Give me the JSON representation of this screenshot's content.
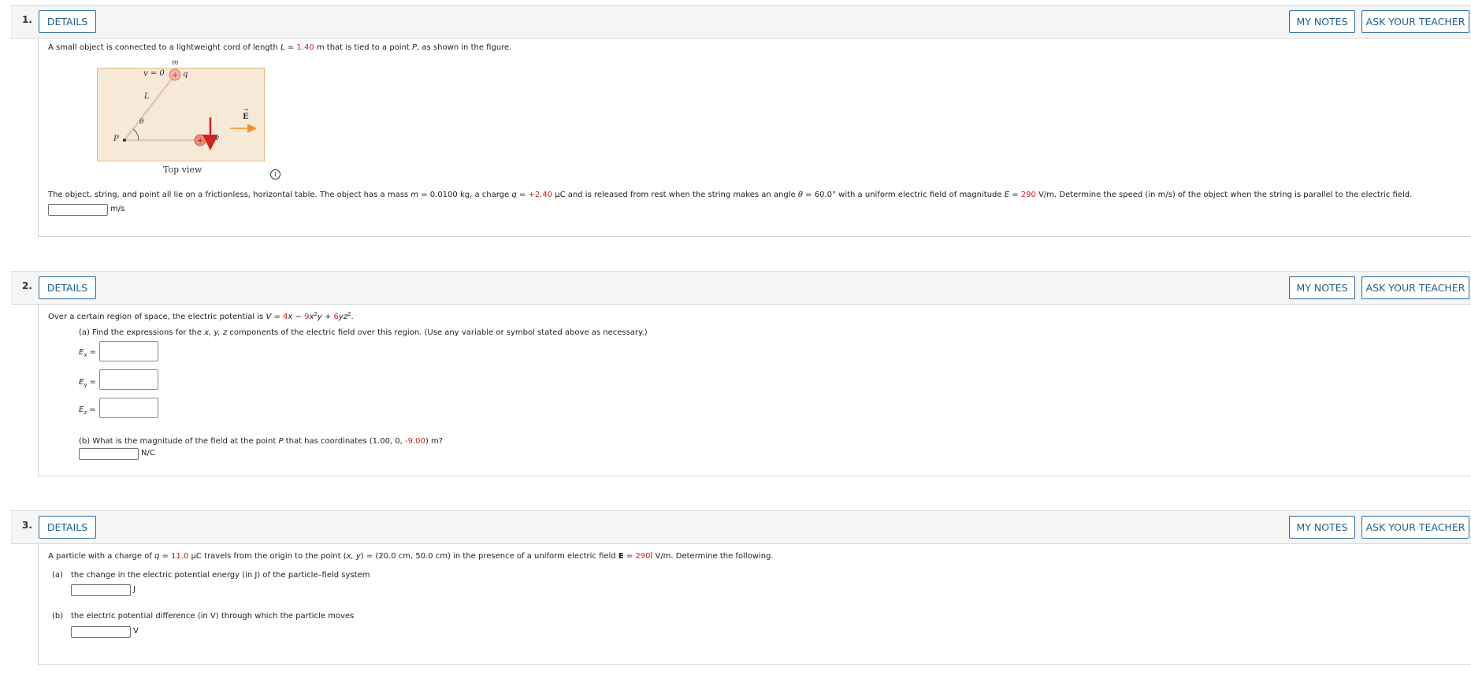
{
  "questions": [
    {
      "number": "1.",
      "details_label": "DETAILS",
      "notes_label": "MY NOTES",
      "teacher_label": "ASK YOUR TEACHER",
      "intro_a": "A small object is connected to a lightweight cord of length ",
      "intro_L": "L",
      "intro_eq": " = ",
      "intro_Lval": "1.40",
      "intro_b": " m that is tied to a point ",
      "intro_P": "P",
      "intro_c": ", as shown in the figure.",
      "figure": {
        "v_label": "v = 0",
        "m_label": "m",
        "q_label": "q",
        "L_label": "L",
        "theta_label": "θ",
        "P_label": "P",
        "E_label": "E",
        "v_vec_label": "v",
        "caption": "Top view"
      },
      "body_a": "The object, string, and point all lie on a frictionless, horizontal table. The object has a mass ",
      "body_m": "m",
      "body_b": " = 0.0100 kg, a charge ",
      "body_q": "q",
      "body_c": " = ",
      "body_qval": "+2.40",
      "body_d": " μC and is released from rest when the string makes an angle ",
      "body_theta": "θ",
      "body_e": " = 60.0° with a uniform electric field of magnitude ",
      "body_E": "E",
      "body_f": " = ",
      "body_Eval": "290",
      "body_g": " V/m. Determine the speed (in m/s) of the object when the string is parallel to the electric field.",
      "unit": "m/s"
    },
    {
      "number": "2.",
      "details_label": "DETAILS",
      "notes_label": "MY NOTES",
      "teacher_label": "ASK YOUR TEACHER",
      "intro_a": "Over a certain region of space, the electric potential is ",
      "intro_V": "V",
      "intro_eq": " = ",
      "intro_c1": "4",
      "intro_x": "x",
      "intro_minus": " − ",
      "intro_c2": "9",
      "intro_x2": "x",
      "intro_y": "y",
      "intro_plus": " + ",
      "intro_c3": "6",
      "intro_yz": "yz",
      "intro_end": ".",
      "part_a": "(a) Find the expressions for the ",
      "part_a_vars": "x, y, z",
      "part_a_rest": " components of the electric field over this region. (Use any variable or symbol stated above as necessary.)",
      "ex_label": "E",
      "ex_sub": "x",
      "ey_label": "E",
      "ey_sub": "y",
      "ez_label": "E",
      "ez_sub": "z",
      "eq_sign": " =",
      "part_b_a": "(b) What is the magnitude of the field at the point ",
      "part_b_P": "P",
      "part_b_b": " that has coordinates (1.00, 0, ",
      "part_b_val": "-9.00",
      "part_b_c": ") m?",
      "unit": "N/C"
    },
    {
      "number": "3.",
      "details_label": "DETAILS",
      "notes_label": "MY NOTES",
      "teacher_label": "ASK YOUR TEACHER",
      "intro_a": "A particle with a charge of ",
      "intro_q": "q",
      "intro_eq": " = ",
      "intro_qval": "11.0",
      "intro_b": " μC travels from the origin to the point (",
      "intro_xy": "x, y",
      "intro_c": ") = (20.0 cm, 50.0 cm) in the presence of a uniform electric field ",
      "intro_E": "E",
      "intro_d": " = ",
      "intro_Eval": "290",
      "intro_e": "î V/m. Determine the following.",
      "part_a_tag": "(a)",
      "part_a_text": "the change in the electric potential energy (in J) of the particle–field system",
      "part_a_unit": "J",
      "part_b_tag": "(b)",
      "part_b_text": "the electric potential difference (in V) through which the particle moves",
      "part_b_unit": "V"
    }
  ],
  "colors": {
    "accent": "#1f5e93",
    "highlight": "#cc1f1f",
    "figure_bg": "#f6e9d7"
  }
}
